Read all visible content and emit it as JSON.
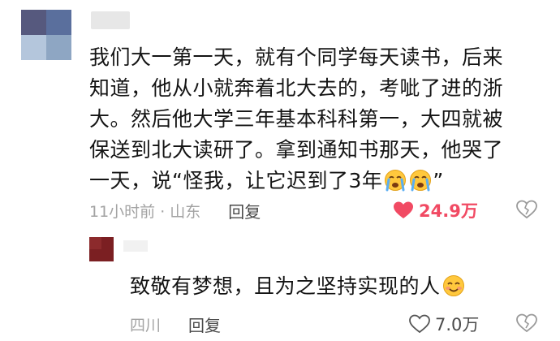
{
  "comment": {
    "lines": [
      "我们大一第一天，就有个同学每天读书，后来",
      "知道，他从小就奔着北大去的，考呲了进的浙",
      "大。然后他大学三年基本科科第一，大四就被",
      "保送到北大读研了。拿到通知书那天，他哭了",
      "一天，说“怪我，让它迟到了3年"
    ],
    "closing_quote": "”",
    "inline_emojis": [
      "crying-face-icon",
      "crying-face-icon"
    ],
    "time_location": "11小时前 · 山东",
    "reply_label": "回复",
    "like_count": "24.9万",
    "liked": true,
    "like_color": "#f14a63"
  },
  "reply": {
    "text": "致敬有梦想，且为之坚持实现的人",
    "emoji": "blushing-smile-icon",
    "location": "四川",
    "reply_label": "回复",
    "like_count": "7.0万",
    "liked": false
  }
}
